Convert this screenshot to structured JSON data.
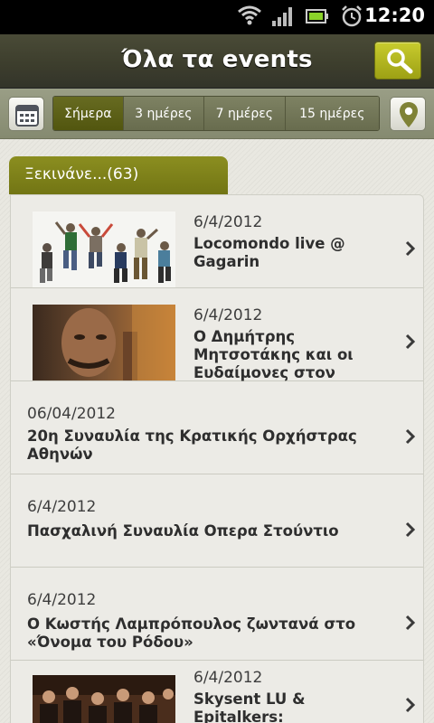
{
  "status_bar": {
    "time": "12:20",
    "icons": [
      "wifi-icon",
      "signal-icon",
      "battery-icon",
      "alarm-icon"
    ]
  },
  "header": {
    "title": "Όλα τα events",
    "search_icon": "search-icon"
  },
  "filter_bar": {
    "calendar_icon": "calendar-icon",
    "location_icon": "location-pin-icon",
    "segments": [
      "Σήμερα",
      "3 ημέρες",
      "7 ημέρες",
      "15 ημέρες"
    ],
    "active_segment": "Σήμερα"
  },
  "section": {
    "tab_label": "Ξεκινάνε...(63)"
  },
  "events": [
    {
      "date": "6/4/2012",
      "title_line1": "Locomondo live @",
      "title_line2": "Gagarin",
      "title_line3": "",
      "has_image": true
    },
    {
      "date": "6/4/2012",
      "title_line1": "Ο Δημήτρης",
      "title_line2": "Μητσοτάκης και οι",
      "title_line3": "Ευδαίμονες στον",
      "has_image": true
    },
    {
      "date": "06/04/2012",
      "title_line1": "20η Συναυλία της Κρατικής Ορχήστρας",
      "title_line2": "Αθηνών",
      "title_line3": "",
      "has_image": false
    },
    {
      "date": "6/4/2012",
      "title_line1": "Πασχαλινή Συναυλία Οπερα Στούντιο",
      "title_line2": "",
      "title_line3": "",
      "has_image": false
    },
    {
      "date": "6/4/2012",
      "title_line1": "Ο Κωστής Λαμπρόπουλος ζωντανά στο",
      "title_line2": "«Όνομα του Ρόδου»",
      "title_line3": "",
      "has_image": false
    },
    {
      "date": "6/4/2012",
      "title_line1": "Skysent LU & Epitalkers:",
      "title_line2": "",
      "title_line3": "",
      "has_image": true
    }
  ],
  "colors": {
    "accent": "#8b8e20",
    "titlebar": "#3d3e2d",
    "background": "#e9e8e1"
  }
}
